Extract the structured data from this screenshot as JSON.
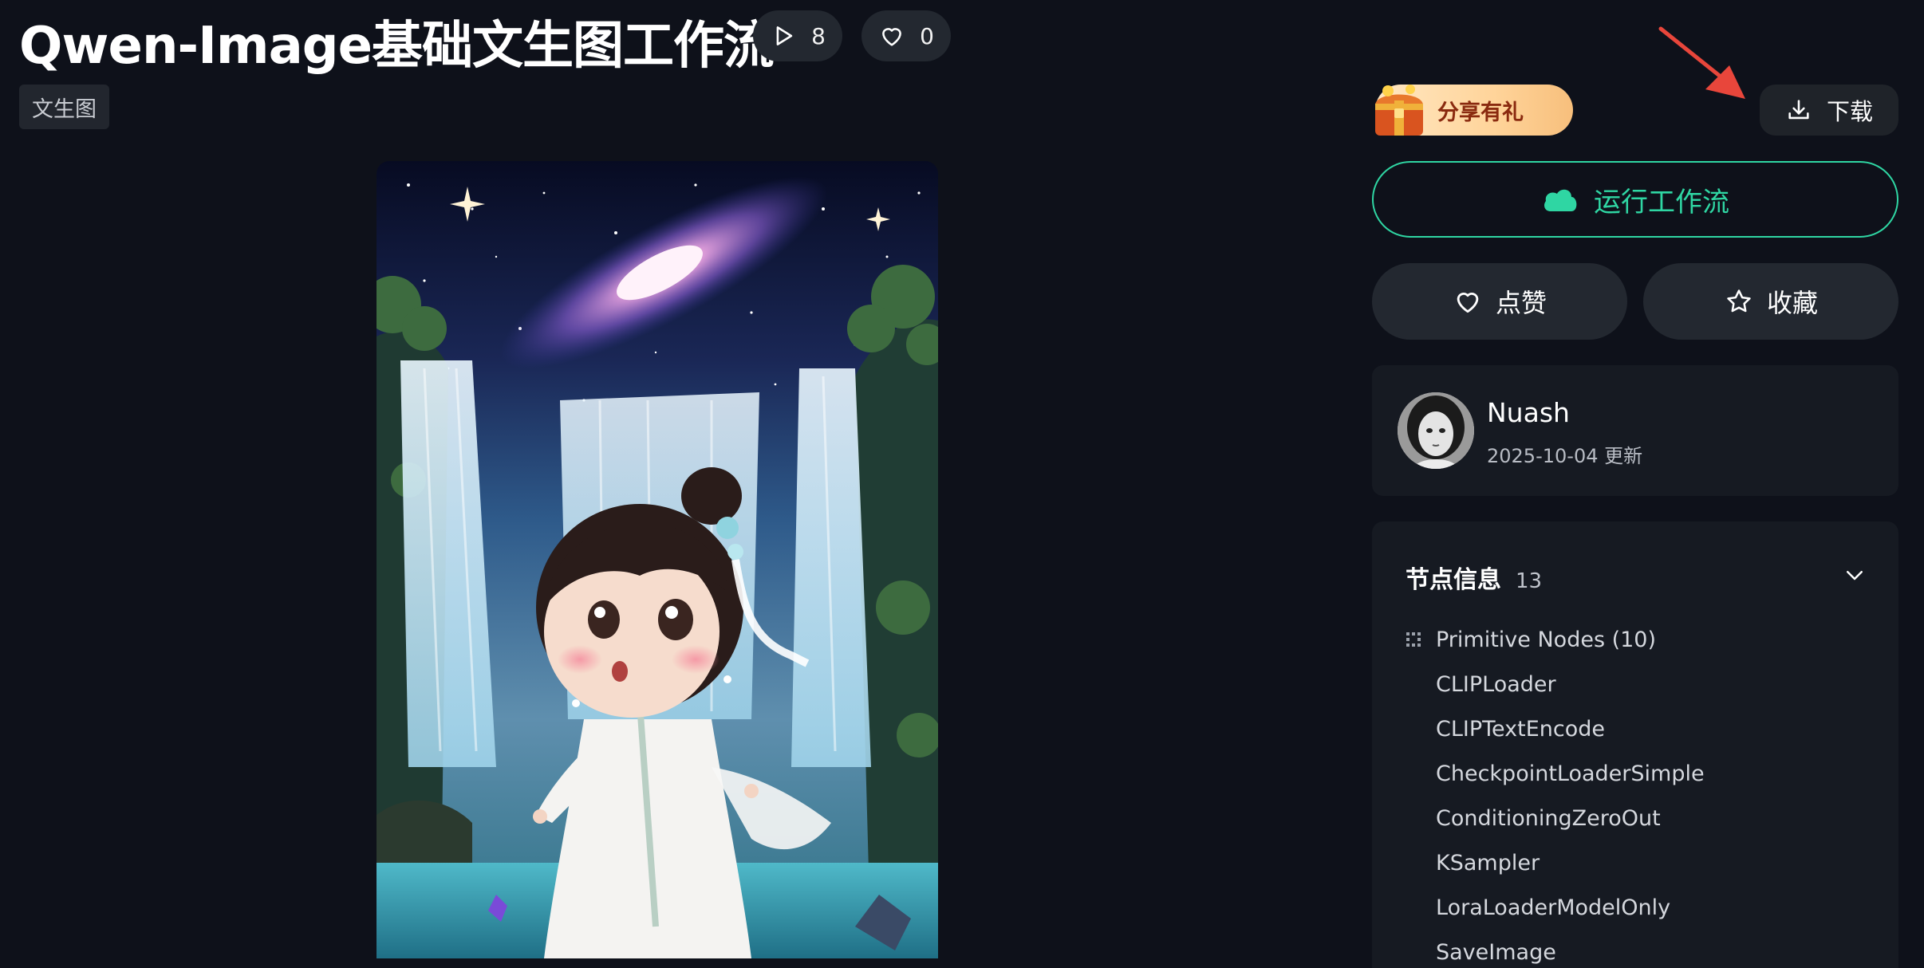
{
  "header": {
    "title": "Qwen-Image基础文生图工作流",
    "runs": "8",
    "likes": "0",
    "tag": "文生图"
  },
  "sidebar": {
    "gift_label": "分享有礼",
    "download_label": "下载",
    "run_label": "运行工作流",
    "like_label": "点赞",
    "favorite_label": "收藏",
    "author": {
      "name": "Nuash",
      "updated": "2025-10-04 更新"
    },
    "nodes": {
      "title": "节点信息",
      "count": "13",
      "items": [
        "Primitive Nodes (10)",
        "CLIPLoader",
        "CLIPTextEncode",
        "CheckpointLoaderSimple",
        "ConditioningZeroOut",
        "KSampler",
        "LoraLoaderModelOnly",
        "SaveImage"
      ]
    }
  },
  "colors": {
    "background": "#0e111a",
    "accent_green": "#2fd6a3",
    "pill_bg": "#232830",
    "annotation_arrow": "#e8463b"
  },
  "icons": [
    "play-icon",
    "heart-icon",
    "gift-chest-icon",
    "download-icon",
    "cloud-icon",
    "star-icon",
    "chevron-down-icon",
    "grid-dots-icon"
  ]
}
